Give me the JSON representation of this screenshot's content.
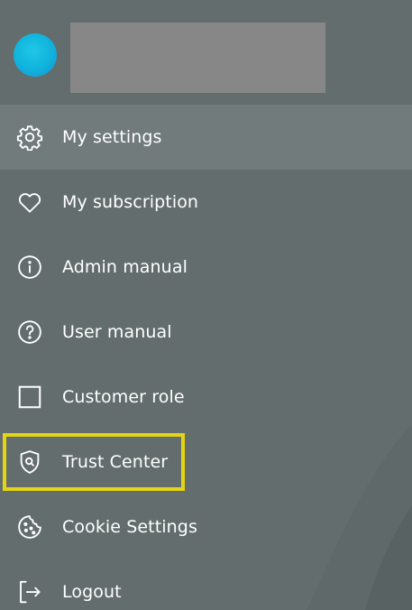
{
  "colors": {
    "background": "#646d6d",
    "active_row": "#727b7b",
    "text": "#ffffff",
    "highlight": "#e3d514",
    "avatar": "#10b2dc",
    "redacted": "#878787"
  },
  "menu": {
    "items": [
      {
        "label": "My settings",
        "icon": "gear-icon",
        "active": true
      },
      {
        "label": "My subscription",
        "icon": "heart-icon",
        "active": false
      },
      {
        "label": "Admin manual",
        "icon": "info-icon",
        "active": false
      },
      {
        "label": "User manual",
        "icon": "question-icon",
        "active": false
      },
      {
        "label": "Customer role",
        "icon": "square-icon",
        "active": false
      },
      {
        "label": "Trust Center",
        "icon": "shield-search-icon",
        "active": false
      },
      {
        "label": "Cookie Settings",
        "icon": "cookie-icon",
        "active": false
      },
      {
        "label": "Logout",
        "icon": "logout-icon",
        "active": false
      }
    ]
  }
}
